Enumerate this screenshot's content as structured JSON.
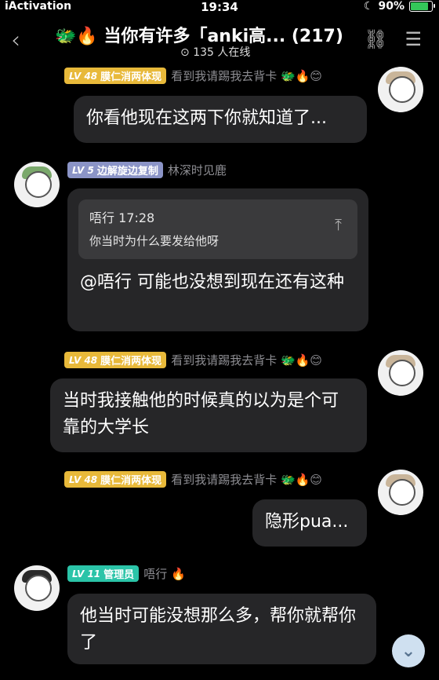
{
  "status": {
    "carrier": "iActivation",
    "time": "19:34",
    "battery": "90%",
    "battery_level": 0.9
  },
  "nav": {
    "title": "🐲🔥 当你有许多「anki高... (217)",
    "online": "135 人在线"
  },
  "messages": [
    {
      "badge_lv": "LV 48",
      "badge_text": "膜仁消两体现",
      "name": "看到我请踢我去背卡 🐲🔥😊",
      "text": "你看他现在这两下你就知道了..."
    },
    {
      "badge_lv": "LV 5",
      "badge_text": "边解旋边复制",
      "name": "林深时见鹿",
      "quote_head": "唔行 17:28",
      "quote_body": "你当时为什么要发给他呀",
      "text": "@唔行 可能也没想到现在还有这种"
    },
    {
      "badge_lv": "LV 48",
      "badge_text": "膜仁消两体现",
      "name": "看到我请踢我去背卡 🐲🔥😊",
      "text": "当时我接触他的时候真的以为是个可靠的大学长"
    },
    {
      "badge_lv": "LV 48",
      "badge_text": "膜仁消两体现",
      "name": "看到我请踢我去背卡 🐲🔥😊",
      "text": "隐形pua..."
    },
    {
      "badge_lv": "LV 11",
      "badge_text": "管理员",
      "name": "唔行 🔥",
      "text": "他当时可能没想那么多，帮你就帮你了"
    }
  ]
}
